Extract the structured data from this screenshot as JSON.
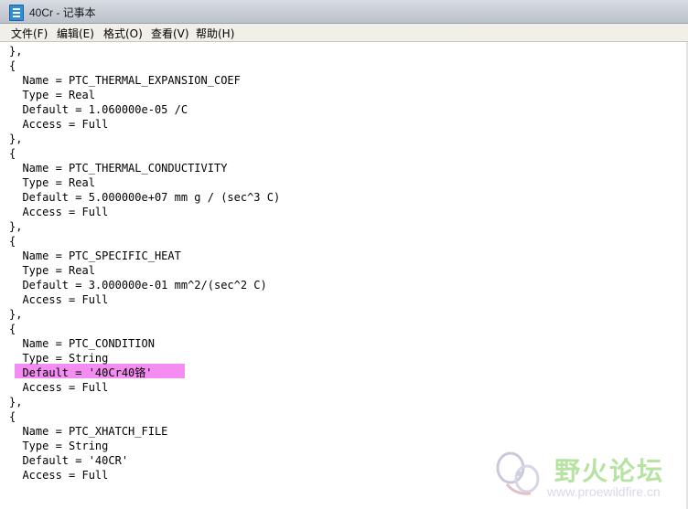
{
  "window": {
    "title": "40Cr - 记事本"
  },
  "menubar": {
    "items": [
      "文件(F)",
      "编辑(E)",
      "格式(O)",
      "查看(V)",
      "帮助(H)"
    ]
  },
  "editor": {
    "lines": [
      "},",
      "{",
      "  Name = PTC_THERMAL_EXPANSION_COEF",
      "  Type = Real",
      "  Default = 1.060000e-05 /C",
      "  Access = Full",
      "},",
      "{",
      "  Name = PTC_THERMAL_CONDUCTIVITY",
      "  Type = Real",
      "  Default = 5.000000e+07 mm g / (sec^3 C)",
      "  Access = Full",
      "},",
      "{",
      "  Name = PTC_SPECIFIC_HEAT",
      "  Type = Real",
      "  Default = 3.000000e-01 mm^2/(sec^2 C)",
      "  Access = Full",
      "},",
      "{",
      "  Name = PTC_CONDITION",
      "  Type = String",
      "  Default = '40Cr40铬'",
      "  Access = Full",
      "},",
      "{",
      "  Name = PTC_XHATCH_FILE",
      "  Type = String",
      "  Default = '40CR'",
      "  Access = Full"
    ],
    "highlight_color": "#f38df1"
  },
  "watermark": {
    "title": "野火论坛",
    "url": "www.proewildfire.cn"
  }
}
